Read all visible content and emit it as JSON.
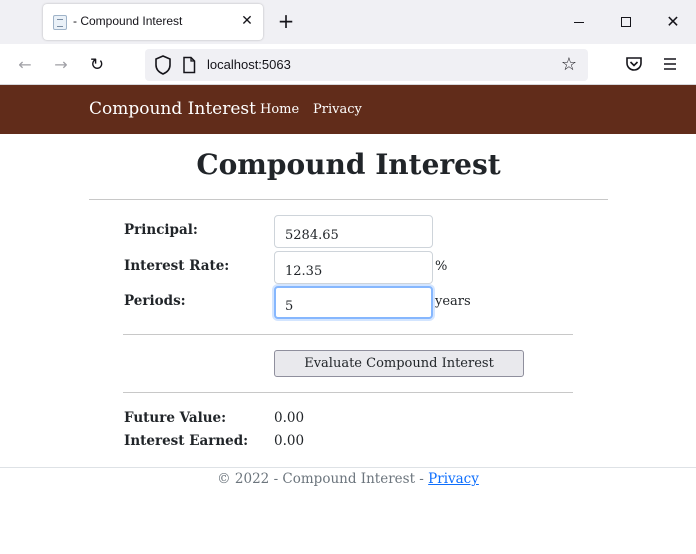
{
  "browser": {
    "tab_title": "- Compound Interest",
    "url": "localhost:5063"
  },
  "site": {
    "brand": "Compound Interest",
    "nav": {
      "home": "Home",
      "privacy": "Privacy"
    }
  },
  "page": {
    "heading": "Compound Interest",
    "form": {
      "principal_label": "Principal:",
      "principal_value": "5284.65",
      "rate_label": "Interest Rate:",
      "rate_value": "12.35",
      "rate_suffix": "%",
      "periods_label": "Periods:",
      "periods_value": "5",
      "periods_suffix": "years",
      "evaluate_button": "Evaluate Compound Interest"
    },
    "results": {
      "future_value_label": "Future Value:",
      "future_value": "0.00",
      "interest_earned_label": "Interest Earned:",
      "interest_earned": "0.00"
    }
  },
  "footer": {
    "text": "© 2022 - Compound Interest - ",
    "privacy_link": "Privacy"
  }
}
